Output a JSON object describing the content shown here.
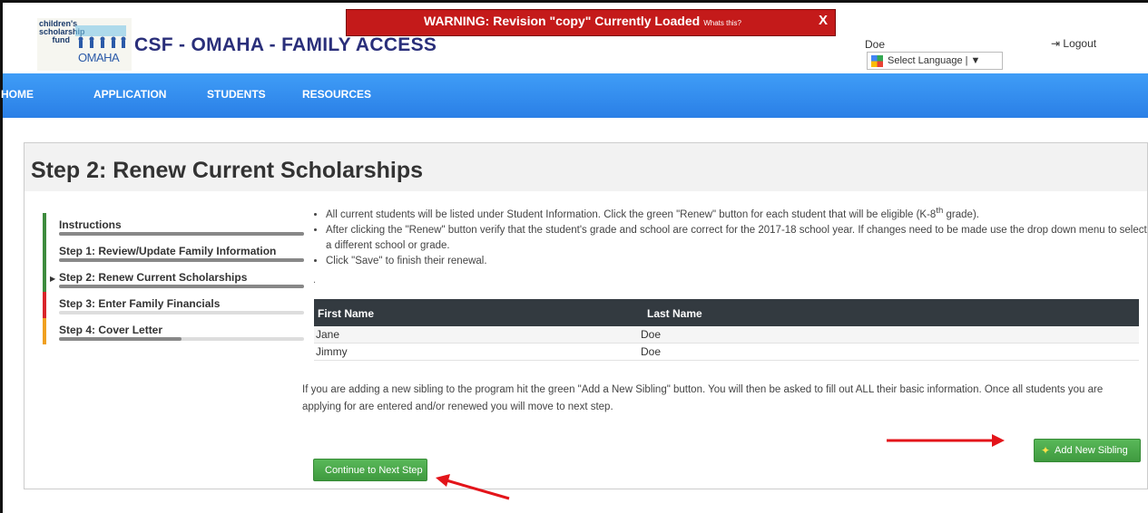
{
  "header": {
    "logo_line1": "children's",
    "logo_line2": "scholarship",
    "logo_line3": "fund",
    "logo_city": "OMAHA",
    "site_title": "CSF - OMAHA - FAMILY ACCESS",
    "user_name": "Doe",
    "language_label": "Select Language | ▼",
    "logout_label": "Logout"
  },
  "warning": {
    "text": "WARNING: Revision \"copy\" Currently Loaded",
    "link": "Whats this?",
    "close": "X"
  },
  "nav": {
    "items": [
      "HOME",
      "APPLICATION",
      "STUDENTS",
      "RESOURCES"
    ]
  },
  "page": {
    "title": "Step 2: Renew Current Scholarships"
  },
  "steps": [
    {
      "label": "Instructions",
      "color": "#3d8b3d",
      "progress": 100
    },
    {
      "label": "Step 1: Review/Update Family Information",
      "color": "#3d8b3d",
      "progress": 100
    },
    {
      "label": "Step 2: Renew Current Scholarships",
      "color": "#3d8b3d",
      "progress": 100,
      "active": true
    },
    {
      "label": "Step 3: Enter Family Financials",
      "color": "#d9242a",
      "progress": 0
    },
    {
      "label": "Step 4: Cover Letter",
      "color": "#f0a020",
      "progress": 50
    }
  ],
  "instructions": {
    "bullet1": "All current students will be listed under Student Information. Click the green \"Renew\" button for each student that will be eligible (K-8",
    "bullet1_sup": "th",
    "bullet1_end": " grade).",
    "bullet2": "After clicking the \"Renew\" button verify that the student's grade and school are correct for the 2017-18 school year. If changes need to be made use the drop down menu to select a different school or grade.",
    "bullet3": "Click \"Save\" to finish their renewal.",
    "dot": "."
  },
  "table": {
    "headers": [
      "First Name",
      "Last Name"
    ],
    "rows": [
      [
        "Jane",
        "Doe"
      ],
      [
        "Jimmy",
        "Doe"
      ]
    ]
  },
  "sibling_text": "If you are adding a new sibling to the program hit the green \"Add a New Sibling\" button. You will then be asked to fill out ALL their basic information. Once all students you are applying for are entered and/or renewed you will move to next step.",
  "buttons": {
    "add_sibling": "Add New Sibling",
    "continue": "Continue to Next Step"
  }
}
